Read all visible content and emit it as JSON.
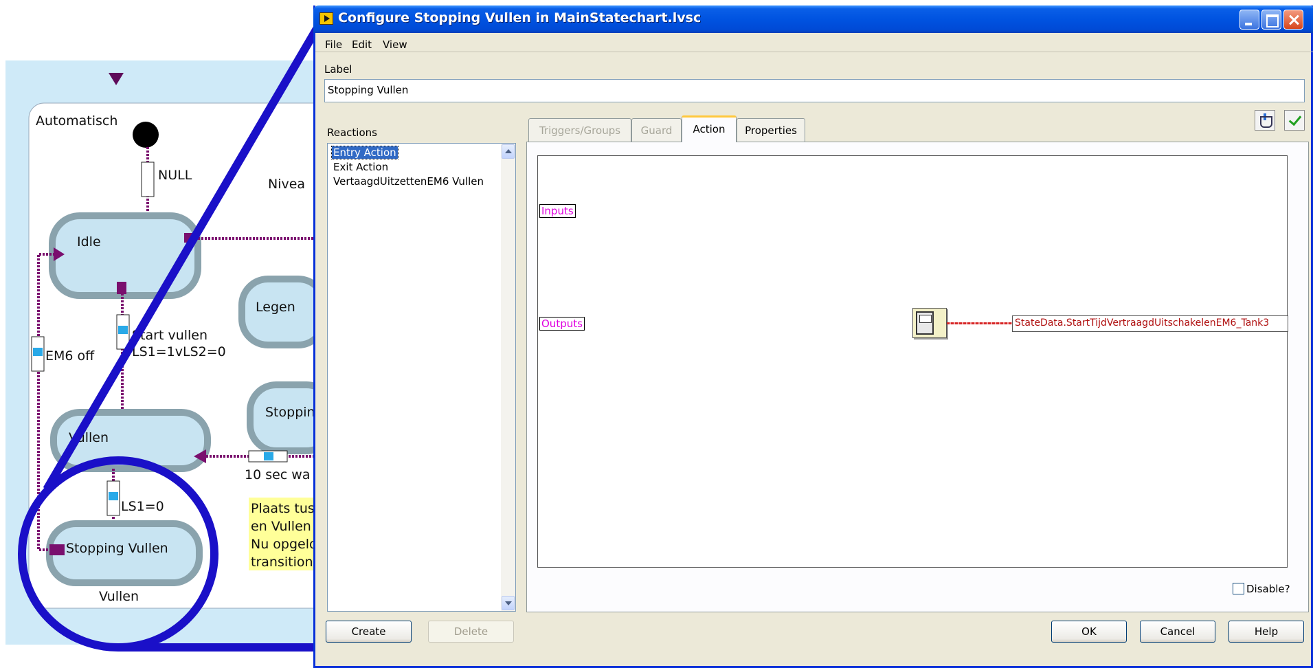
{
  "diagram": {
    "region_label": "Automatisch",
    "states": {
      "idle": "Idle",
      "legen": "Legen",
      "stopping_partial": "Stoppin",
      "vullen_partial": "Vullen",
      "stopping_vullen": "Stopping Vullen"
    },
    "transitions": {
      "null": "NULL",
      "start_vullen_1": "Start vullen",
      "start_vullen_2": "LS1=1vLS2=0",
      "em6_off": "EM6 off",
      "ls1": "LS1=0",
      "wait": "10 sec wa",
      "nivea": "Nivea"
    },
    "note_lines": [
      "Plaats tus",
      "en Vullen",
      "Nu opgelo",
      "transition"
    ],
    "superstate_label": "Vullen"
  },
  "window": {
    "title": "Configure Stopping Vullen in MainStatechart.lvsc",
    "menu": [
      "File",
      "Edit",
      "View"
    ]
  },
  "label_section": {
    "label": "Label",
    "value": "Stopping Vullen"
  },
  "reactions": {
    "label": "Reactions",
    "items": [
      "Entry Action",
      "Exit Action",
      "VertaagdUitzettenEM6 Vullen"
    ],
    "selected": "Entry Action"
  },
  "tabs": [
    {
      "label": "Triggers/Groups",
      "state": "disabled"
    },
    {
      "label": "Guard",
      "state": "disabled"
    },
    {
      "label": "Action",
      "state": "active"
    },
    {
      "label": "Properties",
      "state": "normal"
    }
  ],
  "action_panel": {
    "inputs_label": "Inputs",
    "outputs_label": "Outputs",
    "indicator": "StateData.StartTijdVertraagdUitschakelenEM6_Tank3",
    "disable_label": "Disable?"
  },
  "buttons": {
    "create": "Create",
    "delete": "Delete",
    "ok": "OK",
    "cancel": "Cancel",
    "help": "Help"
  },
  "toolbar_icons": [
    "save-icon",
    "check-icon"
  ],
  "colors": {
    "title_bar": "#0054e3",
    "diagram_bg": "#cfeaf8",
    "state_fill": "#c8e4f2",
    "transition": "#7a0f6e",
    "zoom_circle": "#1a10c8",
    "note": "#ffff99",
    "terminal_text": "#e000e0",
    "indicator_text": "#b01010"
  }
}
